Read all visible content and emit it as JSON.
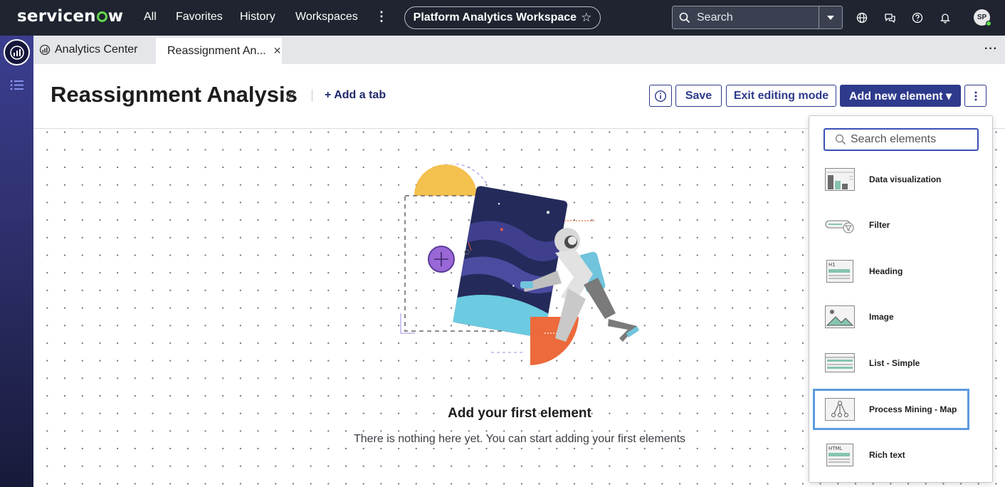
{
  "topnav": {
    "logo": "servicenow",
    "links": [
      "All",
      "Favorites",
      "History",
      "Workspaces"
    ],
    "workspace_pill": "Platform Analytics Workspace",
    "search_placeholder": "Search",
    "avatar_initials": "SP"
  },
  "tabs": {
    "home": "Analytics Center",
    "active": "Reassignment An..."
  },
  "header": {
    "title": "Reassignment Analysis",
    "add_tab": "+ Add a tab",
    "save": "Save",
    "exit_editing": "Exit editing mode",
    "add_element": "Add new element ▾"
  },
  "empty_state": {
    "title": "Add your first element",
    "subtitle": "There is nothing here yet. You can start adding your first elements"
  },
  "element_menu": {
    "search_placeholder": "Search elements",
    "selected_index": 5,
    "items": [
      {
        "label": "Data visualization",
        "icon": "data-visualization-icon"
      },
      {
        "label": "Filter",
        "icon": "filter-icon"
      },
      {
        "label": "Heading",
        "icon": "heading-icon"
      },
      {
        "label": "Image",
        "icon": "image-icon"
      },
      {
        "label": "List - Simple",
        "icon": "list-icon"
      },
      {
        "label": "Process Mining - Map",
        "icon": "process-map-icon"
      },
      {
        "label": "Rich text",
        "icon": "rich-text-icon"
      }
    ]
  },
  "colors": {
    "topnav_bg": "#1f2430",
    "primary": "#2e3a8c",
    "brand_green": "#62d84e",
    "selection_outline": "#5b9be0"
  }
}
